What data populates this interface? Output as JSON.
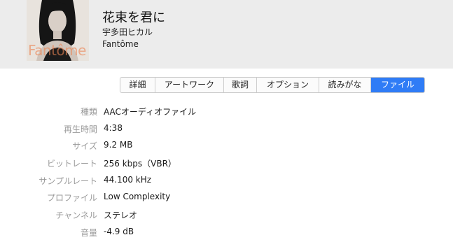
{
  "song": {
    "title": "花束を君に",
    "artist": "宇多田ヒカル",
    "album": "Fantôme"
  },
  "artwork": {
    "text": "Fantôme"
  },
  "tabs": [
    {
      "label": "詳細",
      "active": false
    },
    {
      "label": "アートワーク",
      "active": false
    },
    {
      "label": "歌詞",
      "active": false
    },
    {
      "label": "オプション",
      "active": false
    },
    {
      "label": "読みがな",
      "active": false
    },
    {
      "label": "ファイル",
      "active": true
    }
  ],
  "file_info": [
    {
      "label": "種類",
      "value": "AACオーディオファイル"
    },
    {
      "label": "再生時間",
      "value": "4:38"
    },
    {
      "label": "サイズ",
      "value": "9.2 MB"
    },
    {
      "label": "ビットレート",
      "value": "256 kbps（VBR）"
    },
    {
      "label": "サンプルレート",
      "value": "44.100 kHz"
    },
    {
      "label": "プロファイル",
      "value": "Low Complexity"
    },
    {
      "label": "チャンネル",
      "value": "ステレオ"
    },
    {
      "label": "音量",
      "value": "-4.9 dB"
    }
  ],
  "colors": {
    "header_bg": "#ececec",
    "active_tab": "#2f7cf6",
    "label_gray": "#9a9a9a"
  }
}
